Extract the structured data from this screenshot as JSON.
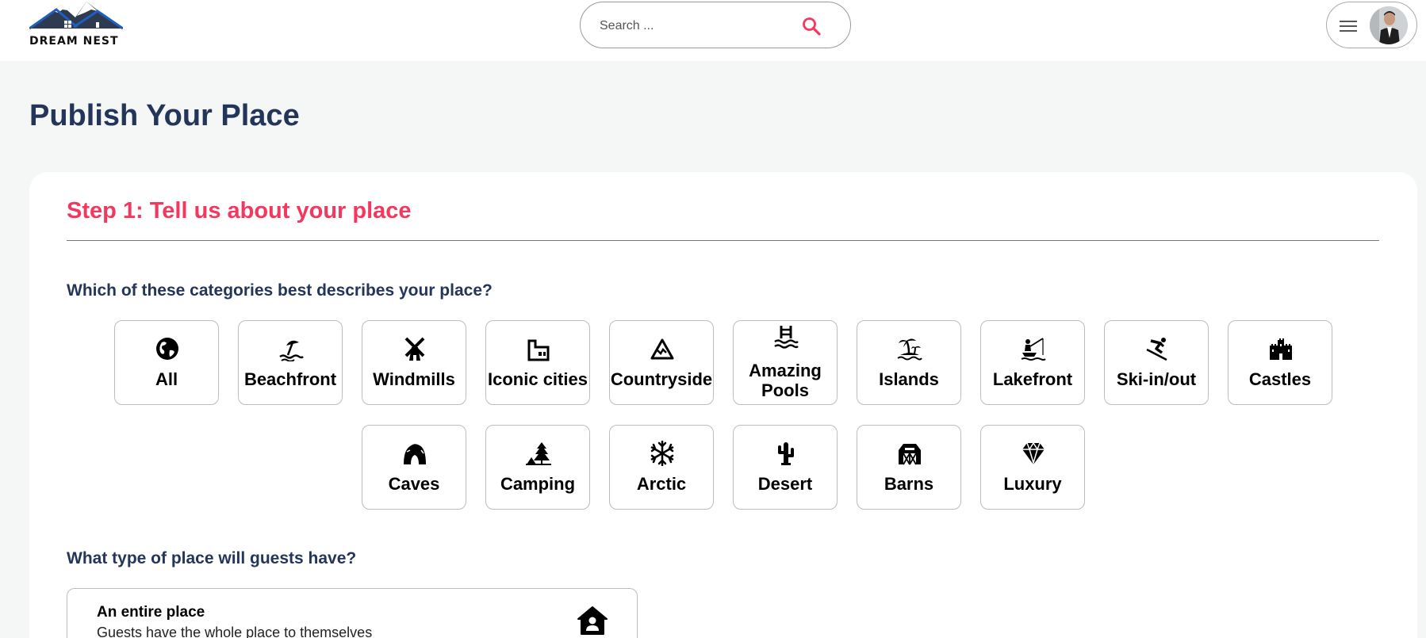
{
  "app": {
    "logo_text": "DREAM NEST"
  },
  "search": {
    "placeholder": "Search ..."
  },
  "page": {
    "title": "Publish Your Place"
  },
  "step": {
    "title": "Step 1: Tell us about your place"
  },
  "questions": {
    "category": "Which of these categories best describes your place?",
    "place_type": "What type of place will guests have?"
  },
  "categories": [
    {
      "label": "All",
      "icon": "globe-icon"
    },
    {
      "label": "Beachfront",
      "icon": "beach-umbrella-icon"
    },
    {
      "label": "Windmills",
      "icon": "windmill-icon"
    },
    {
      "label": "Iconic cities",
      "icon": "city-icon"
    },
    {
      "label": "Countryside",
      "icon": "mountain-icon"
    },
    {
      "label": "Amazing Pools",
      "icon": "pool-ladder-icon"
    },
    {
      "label": "Islands",
      "icon": "island-palm-icon"
    },
    {
      "label": "Lakefront",
      "icon": "fishing-icon"
    },
    {
      "label": "Ski-in/out",
      "icon": "skier-icon"
    },
    {
      "label": "Castles",
      "icon": "castle-icon"
    },
    {
      "label": "Caves",
      "icon": "cave-icon"
    },
    {
      "label": "Camping",
      "icon": "camping-tree-icon"
    },
    {
      "label": "Arctic",
      "icon": "snowflake-icon"
    },
    {
      "label": "Desert",
      "icon": "cactus-icon"
    },
    {
      "label": "Barns",
      "icon": "barn-icon"
    },
    {
      "label": "Luxury",
      "icon": "diamond-icon"
    }
  ],
  "place_types": [
    {
      "title": "An entire place",
      "description": "Guests have the whole place to themselves",
      "icon": "house-user-icon"
    }
  ],
  "colors": {
    "brand_navy": "#24355a",
    "accent_pink": "#f2385e"
  }
}
